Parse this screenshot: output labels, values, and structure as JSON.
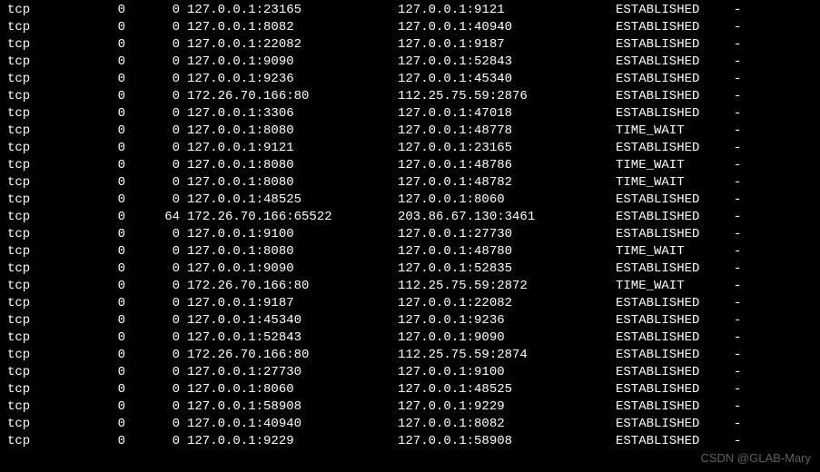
{
  "watermark": "CSDN @GLAB-Mary",
  "connections": [
    {
      "proto": "tcp",
      "recv": "0",
      "send": "0",
      "local": "127.0.0.1:23165",
      "foreign": "127.0.0.1:9121",
      "state": "ESTABLISHED",
      "extra": "-"
    },
    {
      "proto": "tcp",
      "recv": "0",
      "send": "0",
      "local": "127.0.0.1:8082",
      "foreign": "127.0.0.1:40940",
      "state": "ESTABLISHED",
      "extra": "-"
    },
    {
      "proto": "tcp",
      "recv": "0",
      "send": "0",
      "local": "127.0.0.1:22082",
      "foreign": "127.0.0.1:9187",
      "state": "ESTABLISHED",
      "extra": "-"
    },
    {
      "proto": "tcp",
      "recv": "0",
      "send": "0",
      "local": "127.0.0.1:9090",
      "foreign": "127.0.0.1:52843",
      "state": "ESTABLISHED",
      "extra": "-"
    },
    {
      "proto": "tcp",
      "recv": "0",
      "send": "0",
      "local": "127.0.0.1:9236",
      "foreign": "127.0.0.1:45340",
      "state": "ESTABLISHED",
      "extra": "-"
    },
    {
      "proto": "tcp",
      "recv": "0",
      "send": "0",
      "local": "172.26.70.166:80",
      "foreign": "112.25.75.59:2876",
      "state": "ESTABLISHED",
      "extra": "-"
    },
    {
      "proto": "tcp",
      "recv": "0",
      "send": "0",
      "local": "127.0.0.1:3306",
      "foreign": "127.0.0.1:47018",
      "state": "ESTABLISHED",
      "extra": "-"
    },
    {
      "proto": "tcp",
      "recv": "0",
      "send": "0",
      "local": "127.0.0.1:8080",
      "foreign": "127.0.0.1:48778",
      "state": "TIME_WAIT",
      "extra": "-"
    },
    {
      "proto": "tcp",
      "recv": "0",
      "send": "0",
      "local": "127.0.0.1:9121",
      "foreign": "127.0.0.1:23165",
      "state": "ESTABLISHED",
      "extra": "-"
    },
    {
      "proto": "tcp",
      "recv": "0",
      "send": "0",
      "local": "127.0.0.1:8080",
      "foreign": "127.0.0.1:48786",
      "state": "TIME_WAIT",
      "extra": "-"
    },
    {
      "proto": "tcp",
      "recv": "0",
      "send": "0",
      "local": "127.0.0.1:8080",
      "foreign": "127.0.0.1:48782",
      "state": "TIME_WAIT",
      "extra": "-"
    },
    {
      "proto": "tcp",
      "recv": "0",
      "send": "0",
      "local": "127.0.0.1:48525",
      "foreign": "127.0.0.1:8060",
      "state": "ESTABLISHED",
      "extra": "-"
    },
    {
      "proto": "tcp",
      "recv": "0",
      "send": "64",
      "local": "172.26.70.166:65522",
      "foreign": "203.86.67.130:3461",
      "state": "ESTABLISHED",
      "extra": "-"
    },
    {
      "proto": "tcp",
      "recv": "0",
      "send": "0",
      "local": "127.0.0.1:9100",
      "foreign": "127.0.0.1:27730",
      "state": "ESTABLISHED",
      "extra": "-"
    },
    {
      "proto": "tcp",
      "recv": "0",
      "send": "0",
      "local": "127.0.0.1:8080",
      "foreign": "127.0.0.1:48780",
      "state": "TIME_WAIT",
      "extra": "-"
    },
    {
      "proto": "tcp",
      "recv": "0",
      "send": "0",
      "local": "127.0.0.1:9090",
      "foreign": "127.0.0.1:52835",
      "state": "ESTABLISHED",
      "extra": "-"
    },
    {
      "proto": "tcp",
      "recv": "0",
      "send": "0",
      "local": "172.26.70.166:80",
      "foreign": "112.25.75.59:2872",
      "state": "TIME_WAIT",
      "extra": "-"
    },
    {
      "proto": "tcp",
      "recv": "0",
      "send": "0",
      "local": "127.0.0.1:9187",
      "foreign": "127.0.0.1:22082",
      "state": "ESTABLISHED",
      "extra": "-"
    },
    {
      "proto": "tcp",
      "recv": "0",
      "send": "0",
      "local": "127.0.0.1:45340",
      "foreign": "127.0.0.1:9236",
      "state": "ESTABLISHED",
      "extra": "-"
    },
    {
      "proto": "tcp",
      "recv": "0",
      "send": "0",
      "local": "127.0.0.1:52843",
      "foreign": "127.0.0.1:9090",
      "state": "ESTABLISHED",
      "extra": "-"
    },
    {
      "proto": "tcp",
      "recv": "0",
      "send": "0",
      "local": "172.26.70.166:80",
      "foreign": "112.25.75.59:2874",
      "state": "ESTABLISHED",
      "extra": "-"
    },
    {
      "proto": "tcp",
      "recv": "0",
      "send": "0",
      "local": "127.0.0.1:27730",
      "foreign": "127.0.0.1:9100",
      "state": "ESTABLISHED",
      "extra": "-"
    },
    {
      "proto": "tcp",
      "recv": "0",
      "send": "0",
      "local": "127.0.0.1:8060",
      "foreign": "127.0.0.1:48525",
      "state": "ESTABLISHED",
      "extra": "-"
    },
    {
      "proto": "tcp",
      "recv": "0",
      "send": "0",
      "local": "127.0.0.1:58908",
      "foreign": "127.0.0.1:9229",
      "state": "ESTABLISHED",
      "extra": "-"
    },
    {
      "proto": "tcp",
      "recv": "0",
      "send": "0",
      "local": "127.0.0.1:40940",
      "foreign": "127.0.0.1:8082",
      "state": "ESTABLISHED",
      "extra": "-"
    },
    {
      "proto": "tcp",
      "recv": "0",
      "send": "0",
      "local": "127.0.0.1:9229",
      "foreign": "127.0.0.1:58908",
      "state": "ESTABLISHED",
      "extra": "-"
    }
  ]
}
